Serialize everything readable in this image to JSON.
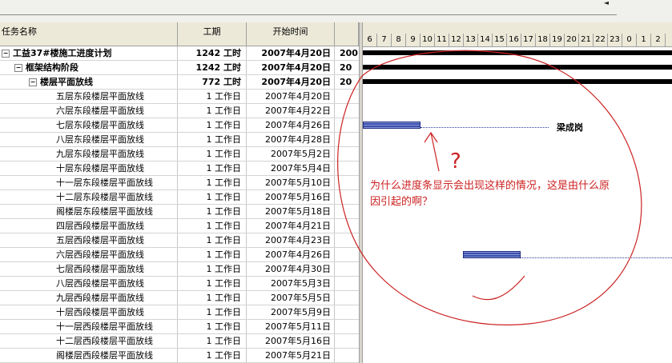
{
  "columns": {
    "name": "任务名称",
    "duration": "工期",
    "start": "开始时间"
  },
  "timescale": [
    "6",
    "7",
    "8",
    "9",
    "10",
    "11",
    "12",
    "13",
    "14",
    "15",
    "16",
    "17",
    "18",
    "19",
    "20",
    "21",
    "22",
    "23",
    "0",
    "1",
    "2"
  ],
  "rows": [
    {
      "name": "工益37#楼施工进度计划",
      "duration": "1242 工时",
      "start": "2007年4月20日",
      "extra": "200",
      "level": 0,
      "bold": true,
      "toggle": "−"
    },
    {
      "name": "框架结构阶段",
      "duration": "1242 工时",
      "start": "2007年4月20日",
      "extra": "20",
      "level": 1,
      "bold": true,
      "toggle": "−"
    },
    {
      "name": "楼层平面放线",
      "duration": "772 工时",
      "start": "2007年4月20日",
      "extra": "20",
      "level": 2,
      "bold": true,
      "toggle": "−"
    },
    {
      "name": "五层东段楼层平面放线",
      "duration": "1 工作日",
      "start": "2007年4月20日",
      "level": 3
    },
    {
      "name": "六层东段楼层平面放线",
      "duration": "1 工作日",
      "start": "2007年4月22日",
      "level": 3
    },
    {
      "name": "七层东段楼层平面放线",
      "duration": "1 工作日",
      "start": "2007年4月26日",
      "level": 3
    },
    {
      "name": "八层东段楼层平面放线",
      "duration": "1 工作日",
      "start": "2007年4月28日",
      "level": 3
    },
    {
      "name": "九层东段楼层平面放线",
      "duration": "1 工作日",
      "start": "2007年5月2日",
      "level": 3
    },
    {
      "name": "十层东段楼层平面放线",
      "duration": "1 工作日",
      "start": "2007年5月4日",
      "level": 3
    },
    {
      "name": "十一层东段楼层平面放线",
      "duration": "1 工作日",
      "start": "2007年5月10日",
      "level": 3
    },
    {
      "name": "十二层东段楼层平面放线",
      "duration": "1 工作日",
      "start": "2007年5月16日",
      "level": 3
    },
    {
      "name": "阁楼层东段楼层平面放线",
      "duration": "1 工作日",
      "start": "2007年5月18日",
      "level": 3
    },
    {
      "name": "四层西段楼层平面放线",
      "duration": "1 工作日",
      "start": "2007年4月21日",
      "level": 3
    },
    {
      "name": "五层西段楼层平面放线",
      "duration": "1 工作日",
      "start": "2007年4月23日",
      "level": 3
    },
    {
      "name": "六层西段楼层平面放线",
      "duration": "1 工作日",
      "start": "2007年4月26日",
      "level": 3
    },
    {
      "name": "七层西段楼层平面放线",
      "duration": "1 工作日",
      "start": "2007年4月30日",
      "level": 3
    },
    {
      "name": "八层西段楼层平面放线",
      "duration": "1 工作日",
      "start": "2007年5月3日",
      "level": 3
    },
    {
      "name": "九层西段楼层平面放线",
      "duration": "1 工作日",
      "start": "2007年5月5日",
      "level": 3
    },
    {
      "name": "十层西段楼层平面放线",
      "duration": "1 工作日",
      "start": "2007年5月9日",
      "level": 3
    },
    {
      "name": "十一层西段楼层平面放线",
      "duration": "1 工作日",
      "start": "2007年5月11日",
      "level": 3
    },
    {
      "name": "十二层西段楼层平面放线",
      "duration": "1 工作日",
      "start": "2007年5月16日",
      "level": 3
    },
    {
      "name": "阁楼层西段楼层平面放线",
      "duration": "1 工作日",
      "start": "2007年5月21日",
      "level": 3
    }
  ],
  "gantt": {
    "resource_label": "梁成岗",
    "annotation": "为什么进度条显示会出现这样的情况，这是由什么原因引起的啊？",
    "annotation_question": "?",
    "colors": {
      "bar": "#3d4fae",
      "annotation": "#cc2222"
    }
  }
}
